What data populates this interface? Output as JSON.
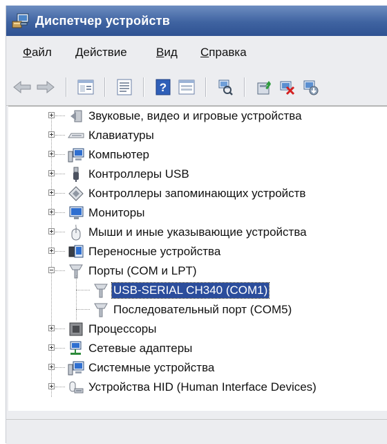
{
  "window": {
    "title": "Диспетчер устройств"
  },
  "menu": [
    {
      "mnemonic": "Ф",
      "rest": "айл"
    },
    {
      "mnemonic": "Д",
      "rest": "ействие"
    },
    {
      "mnemonic": "В",
      "rest": "ид"
    },
    {
      "mnemonic": "С",
      "rest": "правка"
    }
  ],
  "toolbar": {
    "icons": [
      "back-icon",
      "forward-icon",
      "properties-icon",
      "show-hide-tree-icon",
      "help-icon",
      "view-icon",
      "scan-hardware-icon",
      "update-driver-icon",
      "uninstall-icon",
      "disable-device-icon"
    ]
  },
  "tree": {
    "items": [
      {
        "label": "Звуковые, видео и игровые устройства",
        "icon": "speaker-icon",
        "expanded": false
      },
      {
        "label": "Клавиатуры",
        "icon": "keyboard-icon",
        "expanded": false
      },
      {
        "label": "Компьютер",
        "icon": "computer-icon",
        "expanded": false
      },
      {
        "label": "Контроллеры USB",
        "icon": "usb-icon",
        "expanded": false
      },
      {
        "label": "Контроллеры запоминающих устройств",
        "icon": "storage-controller-icon",
        "expanded": false
      },
      {
        "label": "Мониторы",
        "icon": "monitor-icon",
        "expanded": false
      },
      {
        "label": "Мыши и иные указывающие устройства",
        "icon": "mouse-icon",
        "expanded": false
      },
      {
        "label": "Переносные устройства",
        "icon": "portable-device-icon",
        "expanded": false
      },
      {
        "label": "Порты (COM и LPT)",
        "icon": "port-icon",
        "expanded": true,
        "children": [
          {
            "label": "USB-SERIAL CH340 (COM1)",
            "icon": "port-icon",
            "selected": true
          },
          {
            "label": "Последовательный порт (COM5)",
            "icon": "port-icon",
            "selected": false
          }
        ]
      },
      {
        "label": "Процессоры",
        "icon": "processor-icon",
        "expanded": false
      },
      {
        "label": "Сетевые адаптеры",
        "icon": "network-adapter-icon",
        "expanded": false
      },
      {
        "label": "Системные устройства",
        "icon": "system-device-icon",
        "expanded": false
      },
      {
        "label": "Устройства HID (Human Interface Devices)",
        "icon": "hid-icon",
        "expanded": false
      }
    ]
  },
  "colors": {
    "title_bar": "#3f63a1",
    "selection": "#2b4d9c",
    "chrome": "#ecedf0"
  }
}
